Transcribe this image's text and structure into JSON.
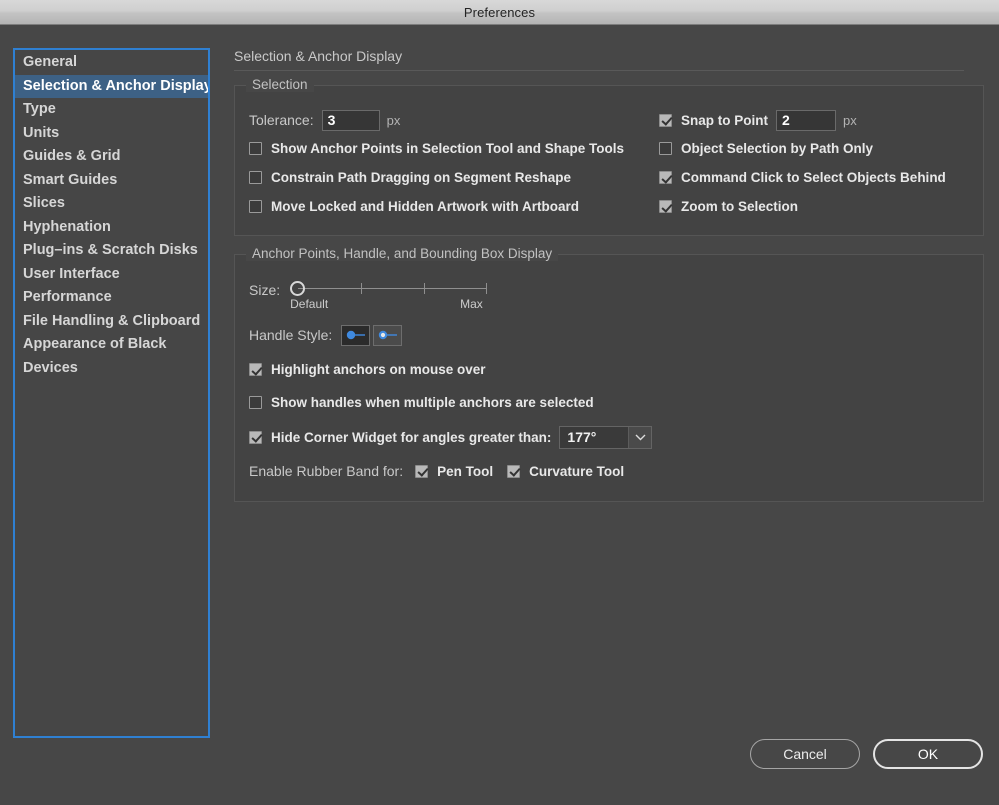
{
  "window": {
    "title": "Preferences"
  },
  "sidebar": {
    "items": [
      {
        "label": "General",
        "selected": false
      },
      {
        "label": "Selection & Anchor Display",
        "selected": true
      },
      {
        "label": "Type",
        "selected": false
      },
      {
        "label": "Units",
        "selected": false
      },
      {
        "label": "Guides & Grid",
        "selected": false
      },
      {
        "label": "Smart Guides",
        "selected": false
      },
      {
        "label": "Slices",
        "selected": false
      },
      {
        "label": "Hyphenation",
        "selected": false
      },
      {
        "label": "Plug–ins & Scratch Disks",
        "selected": false
      },
      {
        "label": "User Interface",
        "selected": false
      },
      {
        "label": "Performance",
        "selected": false
      },
      {
        "label": "File Handling & Clipboard",
        "selected": false
      },
      {
        "label": "Appearance of Black",
        "selected": false
      },
      {
        "label": "Devices",
        "selected": false
      }
    ]
  },
  "pane": {
    "title": "Selection & Anchor Display",
    "selection_group": {
      "legend": "Selection",
      "tolerance_label": "Tolerance:",
      "tolerance_value": "3",
      "tolerance_unit": "px",
      "snap_label": "Snap to Point",
      "snap_checked": true,
      "snap_value": "2",
      "snap_unit": "px",
      "left_checks": [
        {
          "label": "Show Anchor Points in Selection Tool and Shape Tools",
          "checked": false
        },
        {
          "label": "Constrain Path Dragging on Segment Reshape",
          "checked": false
        },
        {
          "label": "Move Locked and Hidden Artwork with Artboard",
          "checked": false
        }
      ],
      "right_checks": [
        {
          "label": "Object Selection by Path Only",
          "checked": false
        },
        {
          "label": "Command Click to Select Objects Behind",
          "checked": true
        },
        {
          "label": "Zoom to Selection",
          "checked": true
        }
      ]
    },
    "anchor_group": {
      "legend": "Anchor Points, Handle, and Bounding Box Display",
      "size_label": "Size:",
      "size_min_label": "Default",
      "size_max_label": "Max",
      "size_value": 0,
      "handle_style_label": "Handle Style:",
      "handle_styles": [
        {
          "name": "solid-handle",
          "selected": true
        },
        {
          "name": "hollow-handle",
          "selected": false
        }
      ],
      "checks": [
        {
          "label": "Highlight anchors on mouse over",
          "checked": true
        },
        {
          "label": "Show handles when multiple anchors are selected",
          "checked": false
        }
      ],
      "corner_widget_label": "Hide Corner Widget for angles greater than:",
      "corner_widget_checked": true,
      "corner_widget_value": "177°",
      "rubber_band_label": "Enable Rubber Band for:",
      "rubber_band_options": [
        {
          "label": "Pen Tool",
          "checked": true
        },
        {
          "label": "Curvature Tool",
          "checked": true
        }
      ]
    }
  },
  "footer": {
    "cancel_label": "Cancel",
    "ok_label": "OK"
  }
}
